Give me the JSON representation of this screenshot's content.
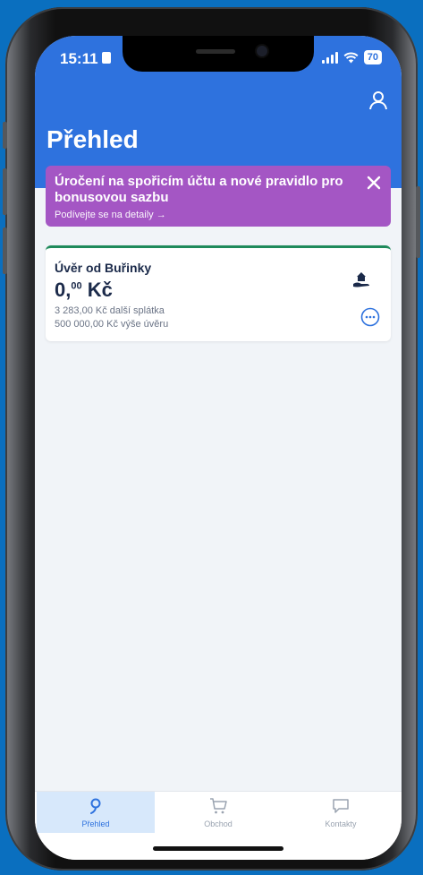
{
  "status_bar": {
    "time": "15:11",
    "battery": "70"
  },
  "header": {
    "title": "Přehled"
  },
  "banner": {
    "text": "Úročení na spořicím účtu a nové pravidlo pro bonusovou sazbu",
    "link": "Podívejte se na detaily →"
  },
  "loan_card": {
    "title": "Úvěr od Buřinky",
    "amount_main": "0,",
    "amount_decimals": "00",
    "amount_currency": " Kč",
    "next_payment": "3 283,00 Kč další splátka",
    "loan_amount": "500 000,00 Kč výše úvěru"
  },
  "tabs": [
    {
      "label": "Přehled",
      "icon": "overview-icon",
      "active": true
    },
    {
      "label": "Obchod",
      "icon": "cart-icon",
      "active": false
    },
    {
      "label": "Kontakty",
      "icon": "chat-icon",
      "active": false
    }
  ],
  "colors": {
    "header": "#2e72de",
    "banner": "#a456c4",
    "card_accent": "#1f8a5b",
    "active_tab": "#d7e8fb"
  }
}
